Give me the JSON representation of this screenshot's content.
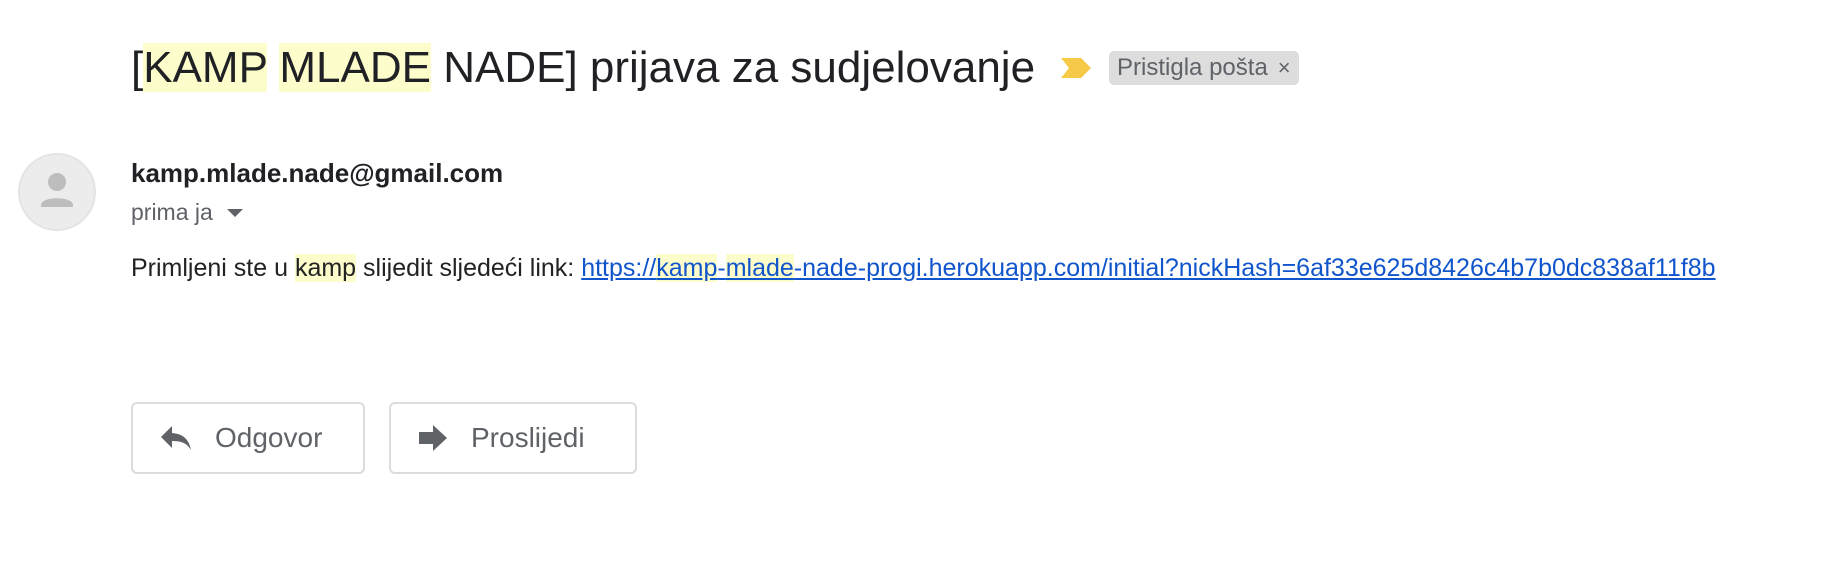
{
  "subject": {
    "part1": "[",
    "part2": "KAMP",
    "part3": " ",
    "part4": "MLADE",
    "part5": " NADE] prijava za sudjelovanje"
  },
  "label": {
    "text": "Pristigla pošta",
    "close": "×"
  },
  "sender": {
    "email": "kamp.mlade.nade@gmail.com",
    "recipient_text": "prima ja"
  },
  "message": {
    "text1": "Primljeni ste u ",
    "text2": "kamp",
    "text3": " slijedit sljedeći link: ",
    "link1": "https://",
    "link2": "kamp",
    "link3": "-",
    "link4": "mlade",
    "link5": "-nade-progi.herokuapp.com/initial?nickHash=6af33e625d8426c4b7b0dc838af11f8b"
  },
  "actions": {
    "reply": "Odgovor",
    "forward": "Proslijedi"
  },
  "colors": {
    "highlight": "#fdfccb",
    "importance": "#f7c948",
    "link": "#1155cc"
  },
  "icons": [
    "importance-marker-icon",
    "label-close-icon",
    "avatar-person-icon",
    "caret-down-icon",
    "reply-icon",
    "forward-icon"
  ]
}
